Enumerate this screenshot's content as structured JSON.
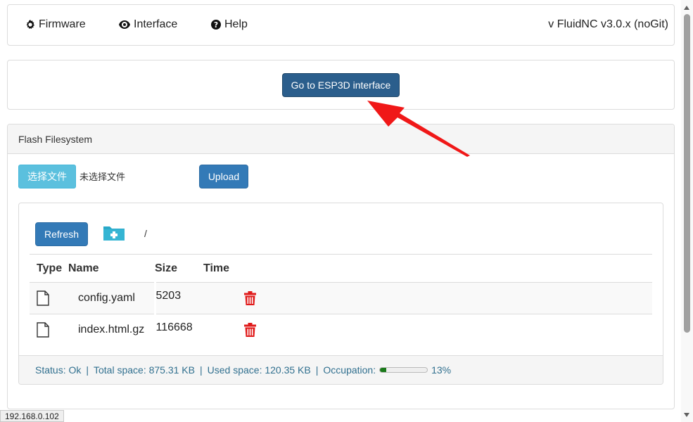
{
  "nav": {
    "firmware_label": "Firmware",
    "interface_label": "Interface",
    "help_label": "Help",
    "version": "v FluidNC v3.0.x (noGit)"
  },
  "esp3d": {
    "button_label": "Go to ESP3D interface"
  },
  "flash": {
    "title": "Flash Filesystem",
    "choose_file_label": "选择文件",
    "no_file_text": "未选择文件",
    "upload_label": "Upload",
    "refresh_label": "Refresh",
    "path": "/",
    "columns": [
      "Type",
      "Name",
      "Size",
      "Time"
    ],
    "files": [
      {
        "name": "config.yaml",
        "size": "5203",
        "time": ""
      },
      {
        "name": "index.html.gz",
        "size": "116668",
        "time": ""
      }
    ],
    "status": {
      "status_text": "Status: Ok",
      "total_space": "Total space: 875.31 KB",
      "used_space": "Used space: 120.35 KB",
      "occupation_label": "Occupation:",
      "occupation_percent": "13%",
      "occupation_value": 13
    }
  },
  "browser": {
    "url_tooltip": "192.168.0.102"
  },
  "icons": {
    "firmware": "gear-icon",
    "interface": "eye-icon",
    "help": "question-circle-icon",
    "new_folder": "folder-plus-icon",
    "file": "file-icon",
    "delete": "trash-icon",
    "annotation": "red-arrow"
  },
  "colors": {
    "primary": "#337ab7",
    "esp3d_button": "#2b5e8c",
    "info": "#5bc0de",
    "danger": "#e01b1b",
    "status_text": "#31708f",
    "occupation_fill": "#1b7a1b",
    "annotation_arrow": "#f01818"
  }
}
